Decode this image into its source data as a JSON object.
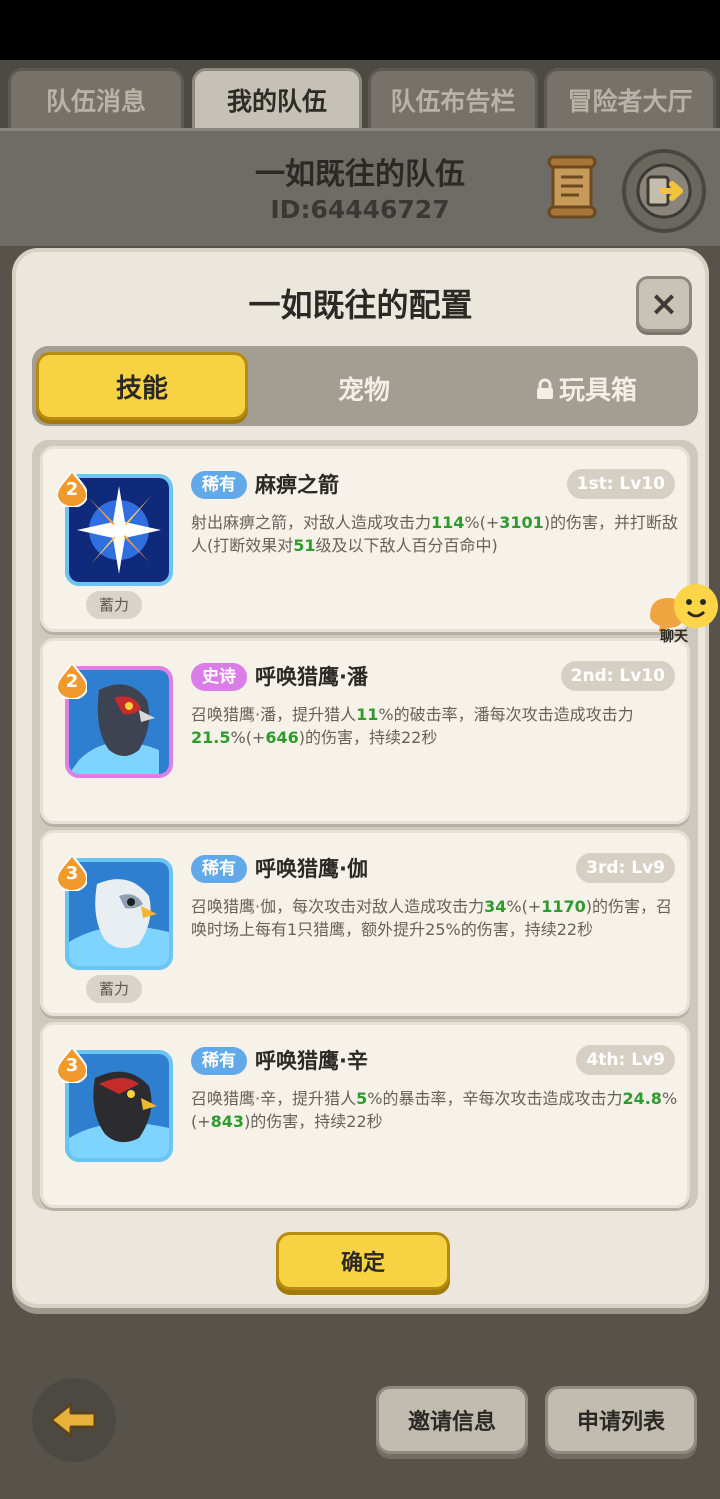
{
  "top_tabs": [
    {
      "label": "队伍消息"
    },
    {
      "label": "我的队伍"
    },
    {
      "label": "队伍布告栏"
    },
    {
      "label": "冒险者大厅"
    }
  ],
  "team": {
    "name": "一如既往的队伍",
    "id_text": "ID:64446727"
  },
  "modal": {
    "title": "一如既往的配置",
    "close_label": "×",
    "tabs": [
      {
        "label": "技能"
      },
      {
        "label": "宠物"
      },
      {
        "label": "玩具箱"
      }
    ],
    "skills": [
      {
        "level": "2",
        "rarity": "稀有",
        "name": "麻痹之箭",
        "slot": "1st: Lv10",
        "charge": "蓄力",
        "desc_parts": [
          "射出麻痹之箭，对敌人造成攻击力",
          "114",
          "%(+",
          "3101",
          ")的伤害，并打断敌人(打断效果对",
          "51",
          "级及以下敌人百分百命中)"
        ]
      },
      {
        "level": "2",
        "rarity": "史诗",
        "name": "呼唤猎鹰·潘",
        "slot": "2nd: Lv10",
        "charge": "",
        "desc_parts": [
          "召唤猎鹰·潘，提升猎人",
          "11",
          "%的破击率，潘每次攻击造成攻击力",
          "21.5",
          "%(+",
          "646",
          ")的伤害，持续22秒"
        ]
      },
      {
        "level": "3",
        "rarity": "稀有",
        "name": "呼唤猎鹰·伽",
        "slot": "3rd: Lv9",
        "charge": "蓄力",
        "desc_parts": [
          "召唤猎鹰·伽，每次攻击对敌人造成攻击力",
          "34",
          "%(+",
          "1170",
          ")的伤害，召唤时场上每有1只猎鹰，额外提升25%的伤害，持续22秒"
        ]
      },
      {
        "level": "3",
        "rarity": "稀有",
        "name": "呼唤猎鹰·辛",
        "slot": "4th: Lv9",
        "charge": "",
        "desc_parts": [
          "召唤猎鹰·辛，提升猎人",
          "5",
          "%的暴击率，辛每次攻击造成攻击力",
          "24.8",
          "%(+",
          "843",
          ")的伤害，持续22秒"
        ]
      }
    ],
    "confirm_label": "确定"
  },
  "chat": {
    "label": "聊天"
  },
  "bottom": {
    "invite_label": "邀请信息",
    "apply_label": "申请列表"
  },
  "colors": {
    "accent_yellow": "#f7d344",
    "rare_blue": "#62a9ea",
    "epic_purple": "#db7de6",
    "highlight_green": "#2f9b2c"
  }
}
